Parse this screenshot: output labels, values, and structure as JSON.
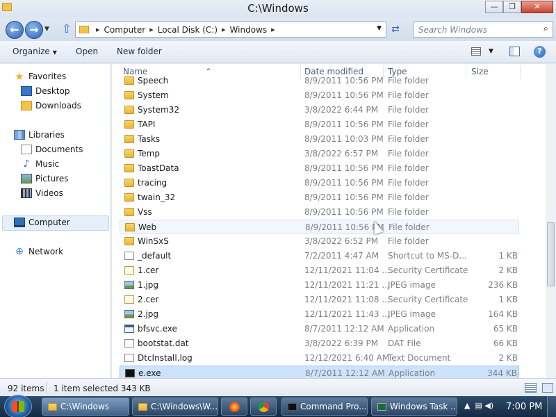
{
  "window": {
    "title": "C:\\Windows",
    "minimize": "—",
    "maximize": "❐",
    "close": "✕"
  },
  "navbar": {
    "back": "←",
    "forward": "→",
    "up": "⇧",
    "breadcrumbs": [
      "Computer",
      "Local Disk (C:)",
      "Windows"
    ],
    "search_placeholder": "Search Windows"
  },
  "commands": {
    "organize": "Organize",
    "open": "Open",
    "new_folder": "New folder"
  },
  "sidebar": {
    "favorites": "Favorites",
    "desktop": "Desktop",
    "downloads": "Downloads",
    "libraries": "Libraries",
    "documents": "Documents",
    "music": "Music",
    "pictures": "Pictures",
    "videos": "Videos",
    "computer": "Computer",
    "network": "Network"
  },
  "columns": {
    "name": "Name",
    "date": "Date modified",
    "type": "Type",
    "size": "Size"
  },
  "files": [
    {
      "name": "Speech",
      "date": "8/9/2011 10:56 PM",
      "type": "File folder",
      "size": "",
      "icon": "folder"
    },
    {
      "name": "System",
      "date": "8/9/2011 10:56 PM",
      "type": "File folder",
      "size": "",
      "icon": "folder"
    },
    {
      "name": "System32",
      "date": "3/8/2022 6:44 PM",
      "type": "File folder",
      "size": "",
      "icon": "folder"
    },
    {
      "name": "TAPI",
      "date": "8/9/2011 10:56 PM",
      "type": "File folder",
      "size": "",
      "icon": "folder"
    },
    {
      "name": "Tasks",
      "date": "8/9/2011 10:03 PM",
      "type": "File folder",
      "size": "",
      "icon": "folder"
    },
    {
      "name": "Temp",
      "date": "3/8/2022 6:57 PM",
      "type": "File folder",
      "size": "",
      "icon": "folder"
    },
    {
      "name": "ToastData",
      "date": "8/9/2011 10:56 PM",
      "type": "File folder",
      "size": "",
      "icon": "folder"
    },
    {
      "name": "tracing",
      "date": "8/9/2011 10:56 PM",
      "type": "File folder",
      "size": "",
      "icon": "folder"
    },
    {
      "name": "twain_32",
      "date": "8/9/2011 10:56 PM",
      "type": "File folder",
      "size": "",
      "icon": "folder"
    },
    {
      "name": "Vss",
      "date": "8/9/2011 10:56 PM",
      "type": "File folder",
      "size": "",
      "icon": "folder"
    },
    {
      "name": "Web",
      "date": "8/9/2011 10:56 PM",
      "type": "File folder",
      "size": "",
      "icon": "folder",
      "state": "hover"
    },
    {
      "name": "WinSxS",
      "date": "3/8/2022 6:52 PM",
      "type": "File folder",
      "size": "",
      "icon": "folder"
    },
    {
      "name": "_default",
      "date": "7/2/2011 4:47 AM",
      "type": "Shortcut to MS-D...",
      "size": "1 KB",
      "icon": "shortcut"
    },
    {
      "name": "1.cer",
      "date": "12/11/2021 11:04 ...",
      "type": "Security Certificate",
      "size": "2 KB",
      "icon": "cert"
    },
    {
      "name": "1.jpg",
      "date": "12/11/2021 11:21 ...",
      "type": "JPEG image",
      "size": "236 KB",
      "icon": "image"
    },
    {
      "name": "2.cer",
      "date": "12/11/2021 11:08 ...",
      "type": "Security Certificate",
      "size": "1 KB",
      "icon": "cert"
    },
    {
      "name": "2.jpg",
      "date": "12/11/2021 11:43 ...",
      "type": "JPEG image",
      "size": "164 KB",
      "icon": "image"
    },
    {
      "name": "bfsvc.exe",
      "date": "8/7/2011 12:12 AM",
      "type": "Application",
      "size": "65 KB",
      "icon": "app"
    },
    {
      "name": "bootstat.dat",
      "date": "3/8/2022 6:39 PM",
      "type": "DAT File",
      "size": "66 KB",
      "icon": "file"
    },
    {
      "name": "DtcInstall.log",
      "date": "12/12/2021 6:40 AM",
      "type": "Text Document",
      "size": "2 KB",
      "icon": "file"
    },
    {
      "name": "e.exe",
      "date": "8/7/2011 12:12 AM",
      "type": "Application",
      "size": "344 KB",
      "icon": "cmd",
      "state": "selected"
    }
  ],
  "status": {
    "item_count": "92 items",
    "selection": "1 item selected  343 KB"
  },
  "taskbar": {
    "explorer1": "C:\\Windows",
    "explorer2": "C:\\Windows\\W...",
    "cmd": "Command Pro...",
    "taskmgr": "Windows Task ...",
    "clock": "7:00 PM"
  }
}
